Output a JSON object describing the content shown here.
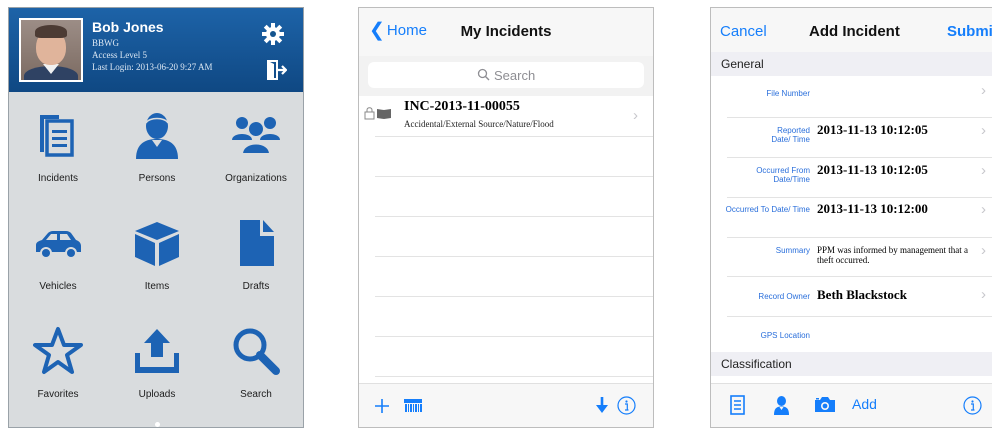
{
  "screen_home": {
    "user": {
      "name": "Bob Jones",
      "org": "BBWG",
      "access": "Access Level 5",
      "last_login": "Last Login: 2013-06-20 9:27 AM"
    },
    "header_icons": [
      "gear-icon",
      "logout-icon"
    ],
    "tiles": [
      {
        "label": "Incidents",
        "icon": "incidents-icon"
      },
      {
        "label": "Persons",
        "icon": "person-icon"
      },
      {
        "label": "Organizations",
        "icon": "organizations-icon"
      },
      {
        "label": "Vehicles",
        "icon": "car-icon"
      },
      {
        "label": "Items",
        "icon": "box-icon"
      },
      {
        "label": "Drafts",
        "icon": "document-icon"
      },
      {
        "label": "Favorites",
        "icon": "star-icon"
      },
      {
        "label": "Uploads",
        "icon": "upload-icon"
      },
      {
        "label": "Search",
        "icon": "search-icon"
      }
    ],
    "colors": {
      "header_blue": "#1a5fa3",
      "icon_blue": "#1d63b4",
      "grid_bg": "#d9dcde"
    }
  },
  "screen_list": {
    "nav": {
      "back_label": "Home",
      "title": "My Incidents"
    },
    "search": {
      "placeholder": "Search"
    },
    "incidents": [
      {
        "number": "INC-2013-11-00055",
        "category": "Accidental/External Source/Nature/Flood"
      }
    ],
    "toolbar_icons": [
      "add-icon",
      "barcode-icon",
      "download-icon",
      "info-icon"
    ]
  },
  "screen_form": {
    "nav": {
      "cancel_label": "Cancel",
      "title": "Add Incident",
      "submit_label": "Submit"
    },
    "sections": {
      "general": "General",
      "classification": "Classification"
    },
    "fields": {
      "file_number": {
        "label": "File Number",
        "value": ""
      },
      "reported": {
        "label": "Reported Date/ Time",
        "value": "2013-11-13 10:12:05"
      },
      "occurred_from": {
        "label": "Occurred From Date/Time",
        "value": "2013-11-13 10:12:05"
      },
      "occurred_to": {
        "label": "Occurred To Date/ Time",
        "value": "2013-11-13 10:12:00"
      },
      "summary": {
        "label": "Summary",
        "value": "PPM was informed by management that a theft occurred."
      },
      "record_owner": {
        "label": "Record Owner",
        "value": "Beth Blackstock"
      },
      "gps": {
        "label": "GPS Location",
        "value": ""
      }
    },
    "toolbar": {
      "add_label": "Add",
      "icons": [
        "notes-icon",
        "person-icon",
        "camera-icon",
        "info-icon"
      ]
    },
    "colors": {
      "ios_blue": "#157efb",
      "label_blue": "#2a6fdb"
    }
  }
}
